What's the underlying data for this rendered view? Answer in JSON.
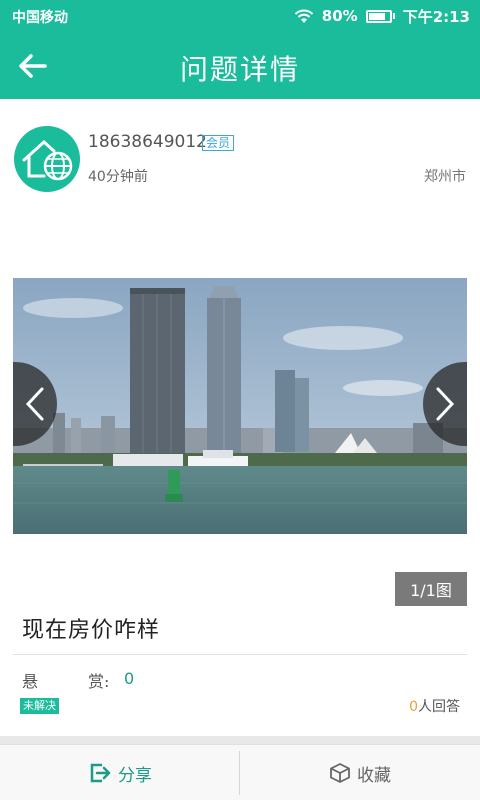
{
  "status_bar": {
    "carrier": "中国移动",
    "battery": "80%",
    "time": "下午2:13"
  },
  "header": {
    "title": "问题详情",
    "back_icon": "arrow-left-icon"
  },
  "post": {
    "username": "18638649012",
    "member_badge": "会员",
    "time_ago": "40分钟前",
    "city": "郑州市",
    "image_counter": "1/1图",
    "question_title": "现在房价咋样",
    "reward_label_1": "悬",
    "reward_label_2": "赏:",
    "reward_value": "0",
    "status_badge": "未解决",
    "answer_count": "0",
    "answer_suffix": "人回答"
  },
  "bottom_bar": {
    "share_label": "分享",
    "favorite_label": "收藏"
  },
  "colors": {
    "accent": "#1abc9c",
    "answer_count": "#e6a23c"
  }
}
